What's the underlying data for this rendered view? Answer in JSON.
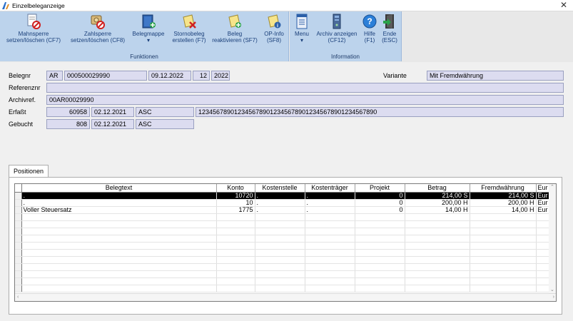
{
  "window": {
    "title": "Einzelbeleganzeige",
    "close_glyph": "✕"
  },
  "ribbon": {
    "groups": [
      {
        "caption": "Funktionen",
        "buttons": [
          {
            "label1": "Mahnsperre",
            "label2": "setzen/löschen (CF7)",
            "icon": "mahnsperre-icon"
          },
          {
            "label1": "Zahlsperre",
            "label2": "setzen/löschen (CF8)",
            "icon": "zahlsperre-icon"
          },
          {
            "label1": "Belegmappe",
            "label2": "▾",
            "icon": "belegmappe-icon"
          },
          {
            "label1": "Stornobeleg",
            "label2": "erstellen (F7)",
            "icon": "stornobeleg-icon"
          },
          {
            "label1": "Beleg",
            "label2": "reaktivieren (SF7)",
            "icon": "beleg-reaktivieren-icon"
          },
          {
            "label1": "OP-Info",
            "label2": "(SF8)",
            "icon": "op-info-icon"
          }
        ]
      },
      {
        "caption": "Information",
        "buttons": [
          {
            "label1": "Menu",
            "label2": "▾",
            "icon": "menu-icon"
          },
          {
            "label1": "Archiv anzeigen",
            "label2": "(CF12)",
            "icon": "archiv-icon"
          },
          {
            "label1": "Hilfe",
            "label2": "(F1)",
            "icon": "help-icon"
          },
          {
            "label1": "Ende",
            "label2": "(ESC)",
            "icon": "exit-icon"
          }
        ]
      }
    ]
  },
  "form": {
    "belegnr_label": "Belegnr",
    "belegnr": {
      "art": "AR",
      "nummer": "000500029990",
      "datum": "09.12.2022",
      "periode": "12",
      "jahr": "2022"
    },
    "variante_label": "Variante",
    "variante": "Mit Fremdwährung",
    "referenznr_label": "Referenznr",
    "referenznr": "",
    "archivref_label": "Archivref.",
    "archivref": "00AR00029990",
    "erfasst_label": "Erfaßt",
    "erfasst": {
      "nr": "60958",
      "datum": "02.12.2021",
      "user": "ASC",
      "extra": "12345678901234567890123456789012345678901234567890"
    },
    "gebucht_label": "Gebucht",
    "gebucht": {
      "nr": "808",
      "datum": "02.12.2021",
      "user": "ASC"
    }
  },
  "tabs": {
    "positionen": "Positionen"
  },
  "grid": {
    "columns": [
      "Belegtext",
      "Konto",
      "Kostenstelle",
      "Kostenträger",
      "Projekt",
      "Betrag",
      "Fremdwährung",
      "Eur"
    ],
    "rows": [
      [
        ".",
        "10720",
        ".",
        ".",
        "0",
        "214,00 S",
        "214,00 S",
        "Eur"
      ],
      [
        ".",
        "10",
        ".",
        ".",
        "0",
        "200,00 H",
        "200,00 H",
        "Eur"
      ],
      [
        "Voller Steuersatz",
        "1775",
        ".",
        ".",
        "0",
        "14,00 H",
        "14,00 H",
        "Eur"
      ]
    ],
    "selected_row": 0,
    "empty_rows": 11
  },
  "colors": {
    "ribbon_group": "#bcd3ec",
    "ribbon_text": "#1a3f7a",
    "field_bg": "#dcdcf0",
    "selected_row": "#000000"
  }
}
